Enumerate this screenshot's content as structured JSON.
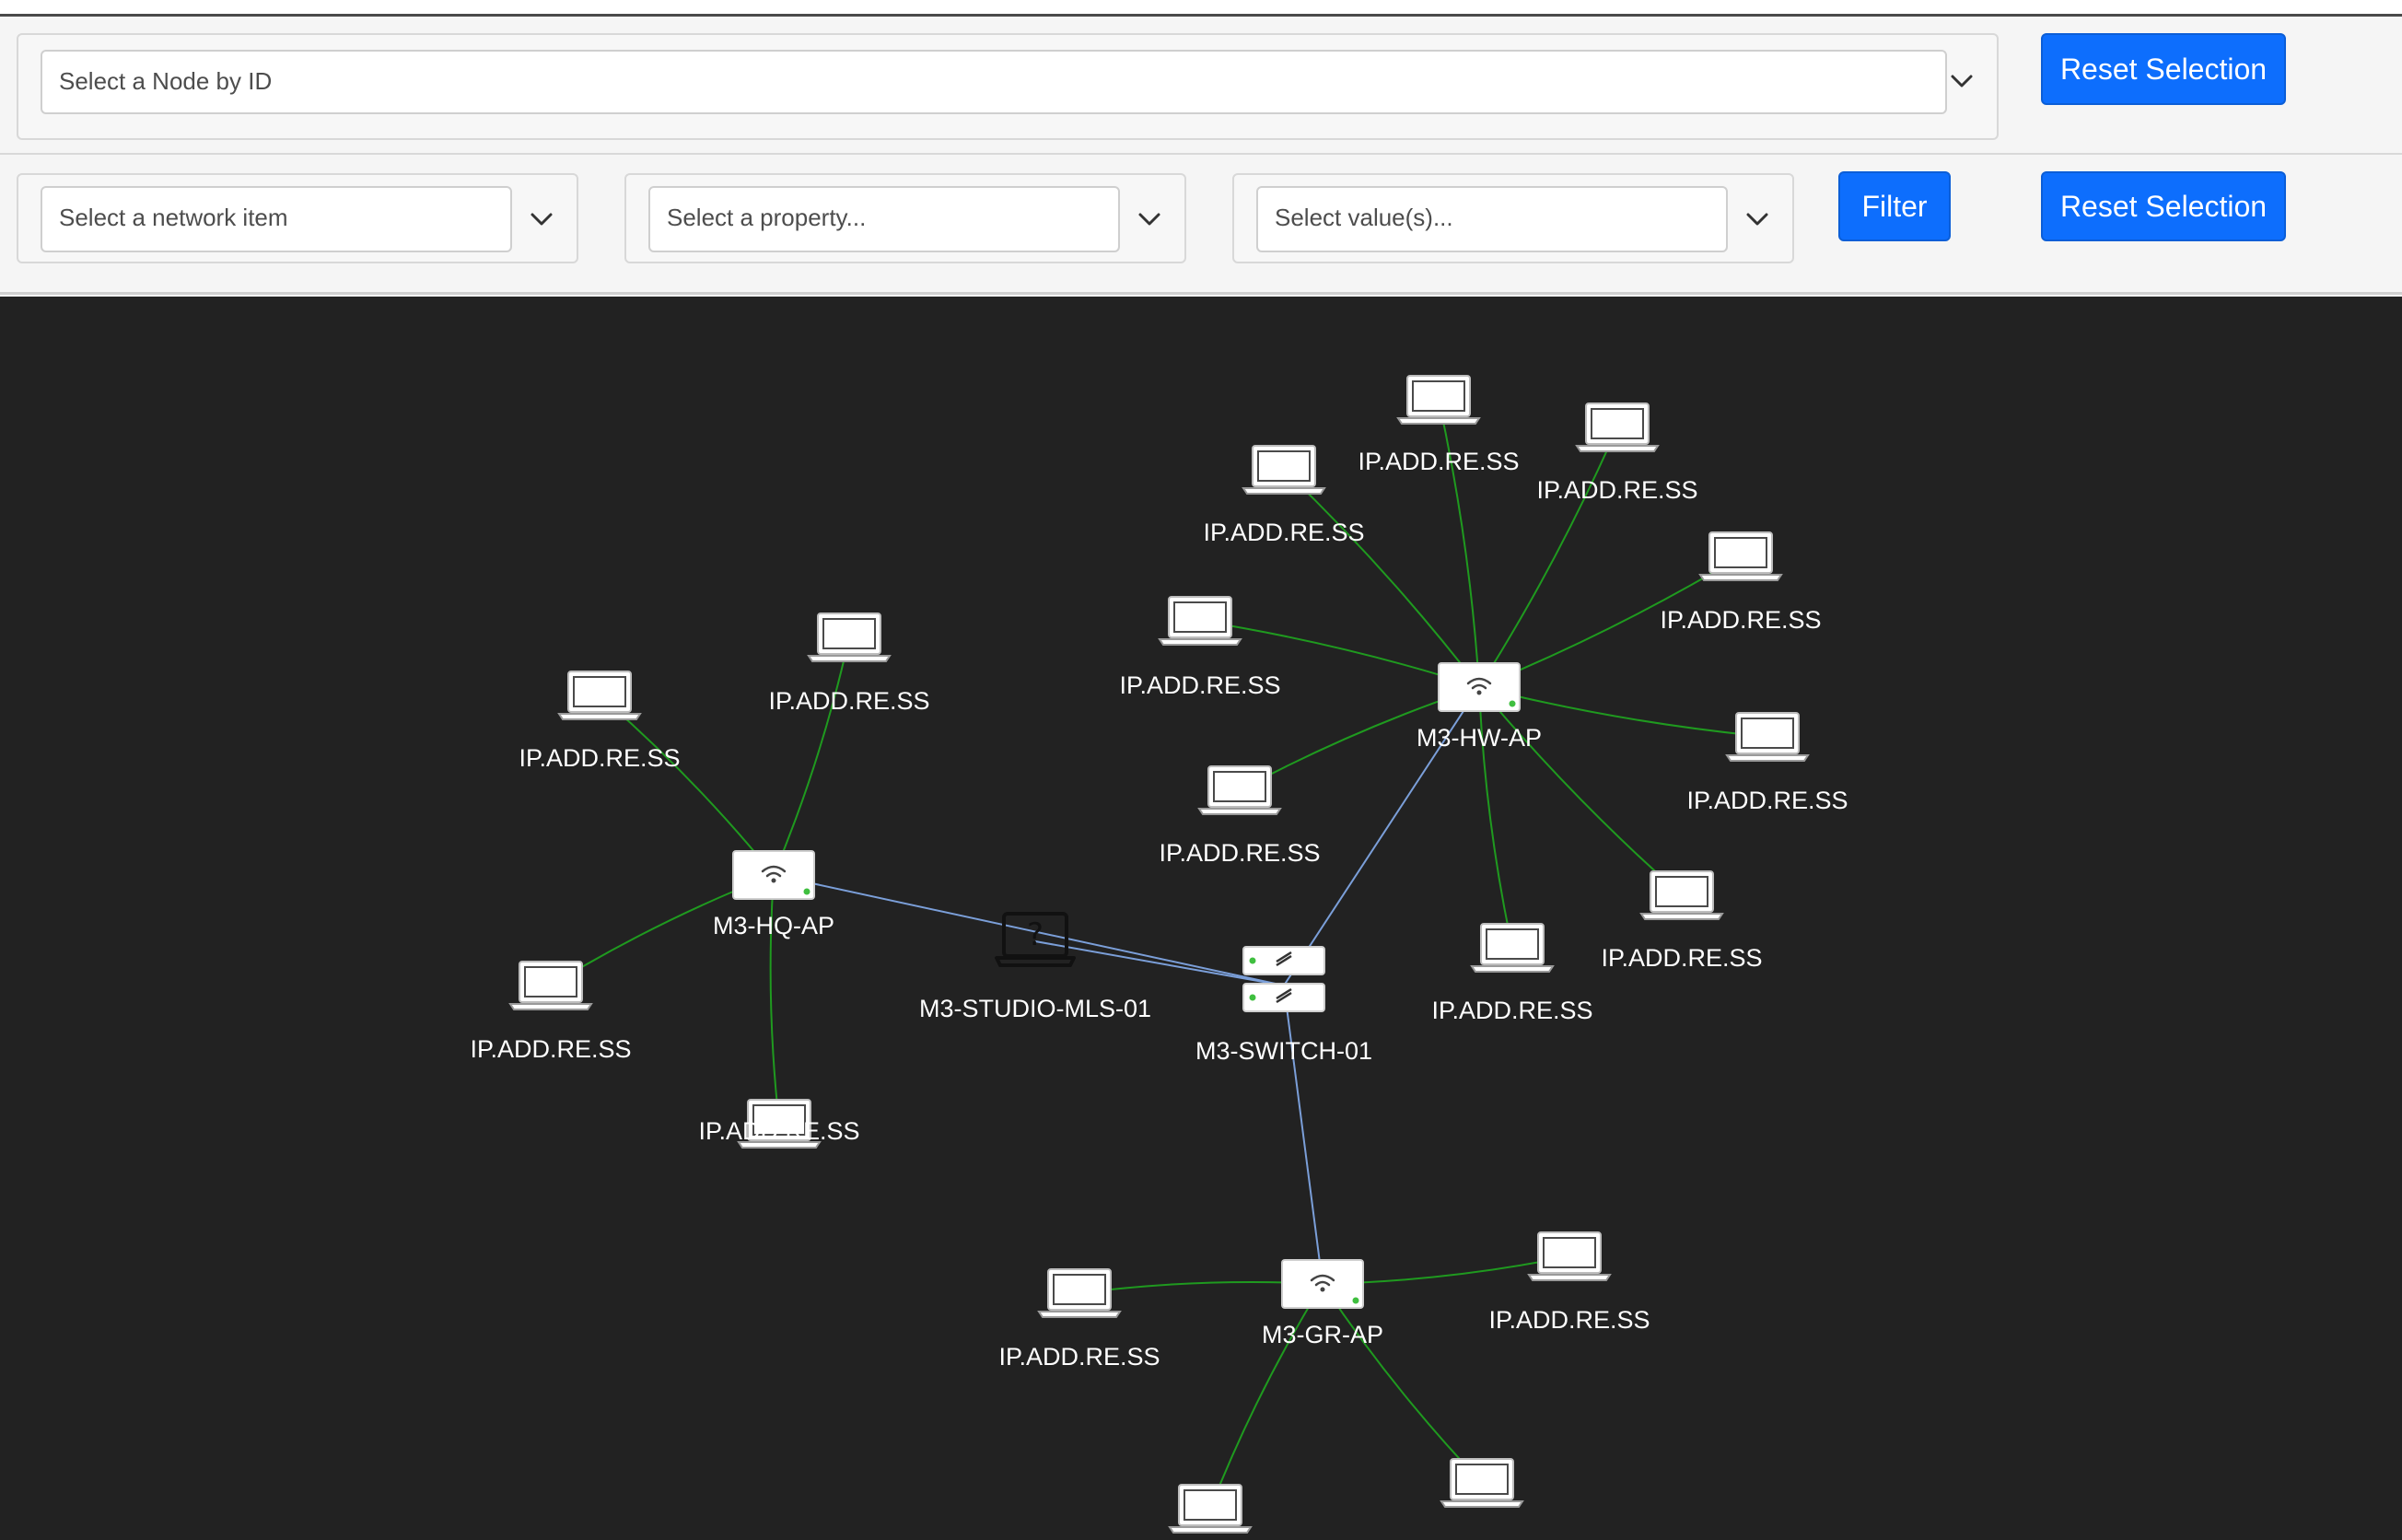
{
  "node_select": {
    "placeholder": "Select a Node by ID",
    "reset_label": "Reset Selection"
  },
  "filter_bar": {
    "network_item_placeholder": "Select a network item",
    "property_placeholder": "Select a property...",
    "value_placeholder": "Select value(s)...",
    "filter_label": "Filter",
    "reset_label": "Reset Selection"
  },
  "graph": {
    "nodes": [
      {
        "id": "hq-ap",
        "type": "ap",
        "label": "M3-HQ-AP"
      },
      {
        "id": "hw-ap",
        "type": "ap",
        "label": "M3-HW-AP"
      },
      {
        "id": "gr-ap",
        "type": "ap",
        "label": "M3-GR-AP"
      },
      {
        "id": "switch",
        "type": "switch",
        "label": "M3-SWITCH-01"
      },
      {
        "id": "studio",
        "type": "unknown",
        "label": "M3-STUDIO-MLS-01"
      },
      {
        "id": "hq-c1",
        "type": "laptop",
        "label": "IP.ADD.RE.SS"
      },
      {
        "id": "hq-c2",
        "type": "laptop",
        "label": "IP.ADD.RE.SS"
      },
      {
        "id": "hq-c3",
        "type": "laptop",
        "label": "IP.ADD.RE.SS"
      },
      {
        "id": "hq-c4",
        "type": "laptop",
        "label": "IP.ADD.RE.SS"
      },
      {
        "id": "hw-c1",
        "type": "laptop",
        "label": "IP.ADD.RE.SS"
      },
      {
        "id": "hw-c2",
        "type": "laptop",
        "label": "IP.ADD.RE.SS"
      },
      {
        "id": "hw-c3",
        "type": "laptop",
        "label": "IP.ADD.RE.SS"
      },
      {
        "id": "hw-c4",
        "type": "laptop",
        "label": "IP.ADD.RE.SS"
      },
      {
        "id": "hw-c5",
        "type": "laptop",
        "label": "IP.ADD.RE.SS"
      },
      {
        "id": "hw-c6",
        "type": "laptop",
        "label": "IP.ADD.RE.SS"
      },
      {
        "id": "hw-c7",
        "type": "laptop",
        "label": "IP.ADD.RE.SS"
      },
      {
        "id": "hw-c8",
        "type": "laptop",
        "label": "IP.ADD.RE.SS"
      },
      {
        "id": "hw-c9",
        "type": "laptop",
        "label": "IP.ADD.RE.SS"
      },
      {
        "id": "gr-c1",
        "type": "laptop",
        "label": "IP.ADD.RE.SS"
      },
      {
        "id": "gr-c2",
        "type": "laptop",
        "label": "IP.ADD.RE.SS"
      },
      {
        "id": "gr-c3",
        "type": "laptop",
        "label": ""
      },
      {
        "id": "gr-c4",
        "type": "laptop",
        "label": ""
      }
    ],
    "edges": [
      {
        "from": "switch",
        "to": "hq-ap",
        "kind": "uplink"
      },
      {
        "from": "switch",
        "to": "studio",
        "kind": "uplink"
      },
      {
        "from": "switch",
        "to": "hw-ap",
        "kind": "uplink"
      },
      {
        "from": "switch",
        "to": "gr-ap",
        "kind": "uplink"
      },
      {
        "from": "hq-ap",
        "to": "hq-c1",
        "kind": "client"
      },
      {
        "from": "hq-ap",
        "to": "hq-c2",
        "kind": "client"
      },
      {
        "from": "hq-ap",
        "to": "hq-c3",
        "kind": "client"
      },
      {
        "from": "hq-ap",
        "to": "hq-c4",
        "kind": "client"
      },
      {
        "from": "hw-ap",
        "to": "hw-c1",
        "kind": "client"
      },
      {
        "from": "hw-ap",
        "to": "hw-c2",
        "kind": "client"
      },
      {
        "from": "hw-ap",
        "to": "hw-c3",
        "kind": "client"
      },
      {
        "from": "hw-ap",
        "to": "hw-c4",
        "kind": "client"
      },
      {
        "from": "hw-ap",
        "to": "hw-c5",
        "kind": "client"
      },
      {
        "from": "hw-ap",
        "to": "hw-c6",
        "kind": "client"
      },
      {
        "from": "hw-ap",
        "to": "hw-c7",
        "kind": "client"
      },
      {
        "from": "hw-ap",
        "to": "hw-c8",
        "kind": "client"
      },
      {
        "from": "hw-ap",
        "to": "hw-c9",
        "kind": "client"
      },
      {
        "from": "gr-ap",
        "to": "gr-c1",
        "kind": "client"
      },
      {
        "from": "gr-ap",
        "to": "gr-c2",
        "kind": "client"
      },
      {
        "from": "gr-ap",
        "to": "gr-c3",
        "kind": "client"
      },
      {
        "from": "gr-ap",
        "to": "gr-c4",
        "kind": "client"
      }
    ],
    "colors": {
      "background": "#222222",
      "uplink_edge": "#7b9fd9",
      "client_edge": "#1f9a1f",
      "label": "#ffffff",
      "status_led": "#3fbf3f"
    }
  }
}
